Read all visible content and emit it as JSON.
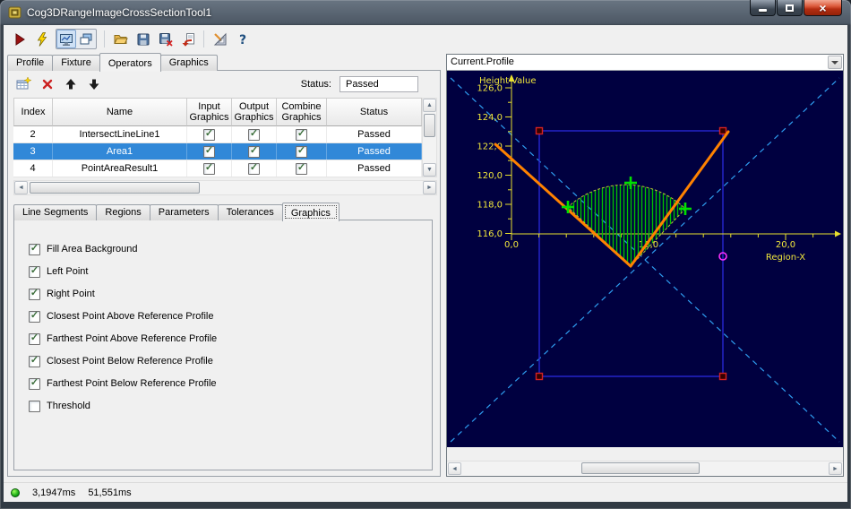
{
  "window": {
    "title": "Cog3DRangeImageCrossSectionTool1"
  },
  "icons": {
    "check": "✓",
    "close": "×",
    "up": "▲",
    "down": "▼",
    "left": "◄",
    "right": "►",
    "toolbar": [
      "run",
      "auto-run",
      "display-toggle",
      "float-display",
      "open",
      "save",
      "save-as",
      "import",
      "measure",
      "help"
    ],
    "operator_toolbar": [
      "add-operator",
      "delete-operator",
      "move-up",
      "move-down"
    ]
  },
  "main_tabs": {
    "items": [
      "Profile",
      "Fixture",
      "Operators",
      "Graphics"
    ],
    "active_index": 2
  },
  "operators": {
    "status_label": "Status:",
    "status_value": "Passed",
    "columns": [
      "Index",
      "Name",
      "Input Graphics",
      "Output Graphics",
      "Combine Graphics",
      "Status"
    ],
    "rows": [
      {
        "index": "2",
        "name": "IntersectLineLine1",
        "input_graphics": true,
        "output_graphics": true,
        "combine_graphics": true,
        "status": "Passed",
        "selected": false
      },
      {
        "index": "3",
        "name": "Area1",
        "input_graphics": true,
        "output_graphics": true,
        "combine_graphics": true,
        "status": "Passed",
        "selected": true
      },
      {
        "index": "4",
        "name": "PointAreaResult1",
        "input_graphics": true,
        "output_graphics": true,
        "combine_graphics": true,
        "status": "Passed",
        "selected": false
      }
    ]
  },
  "sub_tabs": {
    "items": [
      "Line Segments",
      "Regions",
      "Parameters",
      "Tolerances",
      "Graphics"
    ],
    "active_index": 4
  },
  "graphics_options": [
    {
      "label": "Fill Area Background",
      "checked": true
    },
    {
      "label": "Left Point",
      "checked": true
    },
    {
      "label": "Right Point",
      "checked": true
    },
    {
      "label": "Closest Point Above Reference Profile",
      "checked": true
    },
    {
      "label": "Farthest Point Above Reference Profile",
      "checked": true
    },
    {
      "label": "Closest Point Below Reference Profile",
      "checked": true
    },
    {
      "label": "Farthest Point Below Reference Profile",
      "checked": true
    },
    {
      "label": "Threshold",
      "checked": false
    }
  ],
  "profile_panel": {
    "selector": "Current.Profile",
    "plot": {
      "title": "Height-Value",
      "xlabel": "Region-X",
      "y_ticks": [
        "126,0",
        "124,0",
        "122,0",
        "120,0",
        "118,0",
        "116,0"
      ],
      "x_ticks": [
        "0,0",
        "10,0",
        "20,0"
      ],
      "y_range": [
        116.0,
        126.0
      ],
      "x_range": [
        0.0,
        20.0
      ],
      "colors": {
        "background": "#000040",
        "axis": "#e8df2e",
        "profile_line": "#ff8200",
        "region_box": "#2424c8",
        "search_diagonals": "#2e9df0",
        "area_hatch": "#00c000",
        "point_marker": "#00e000",
        "below_point_marker": "#ff30ff",
        "corner_handle": "#d42222"
      }
    }
  },
  "status_bar": {
    "process_time": "3,1947ms",
    "total_time": "51,551ms"
  }
}
